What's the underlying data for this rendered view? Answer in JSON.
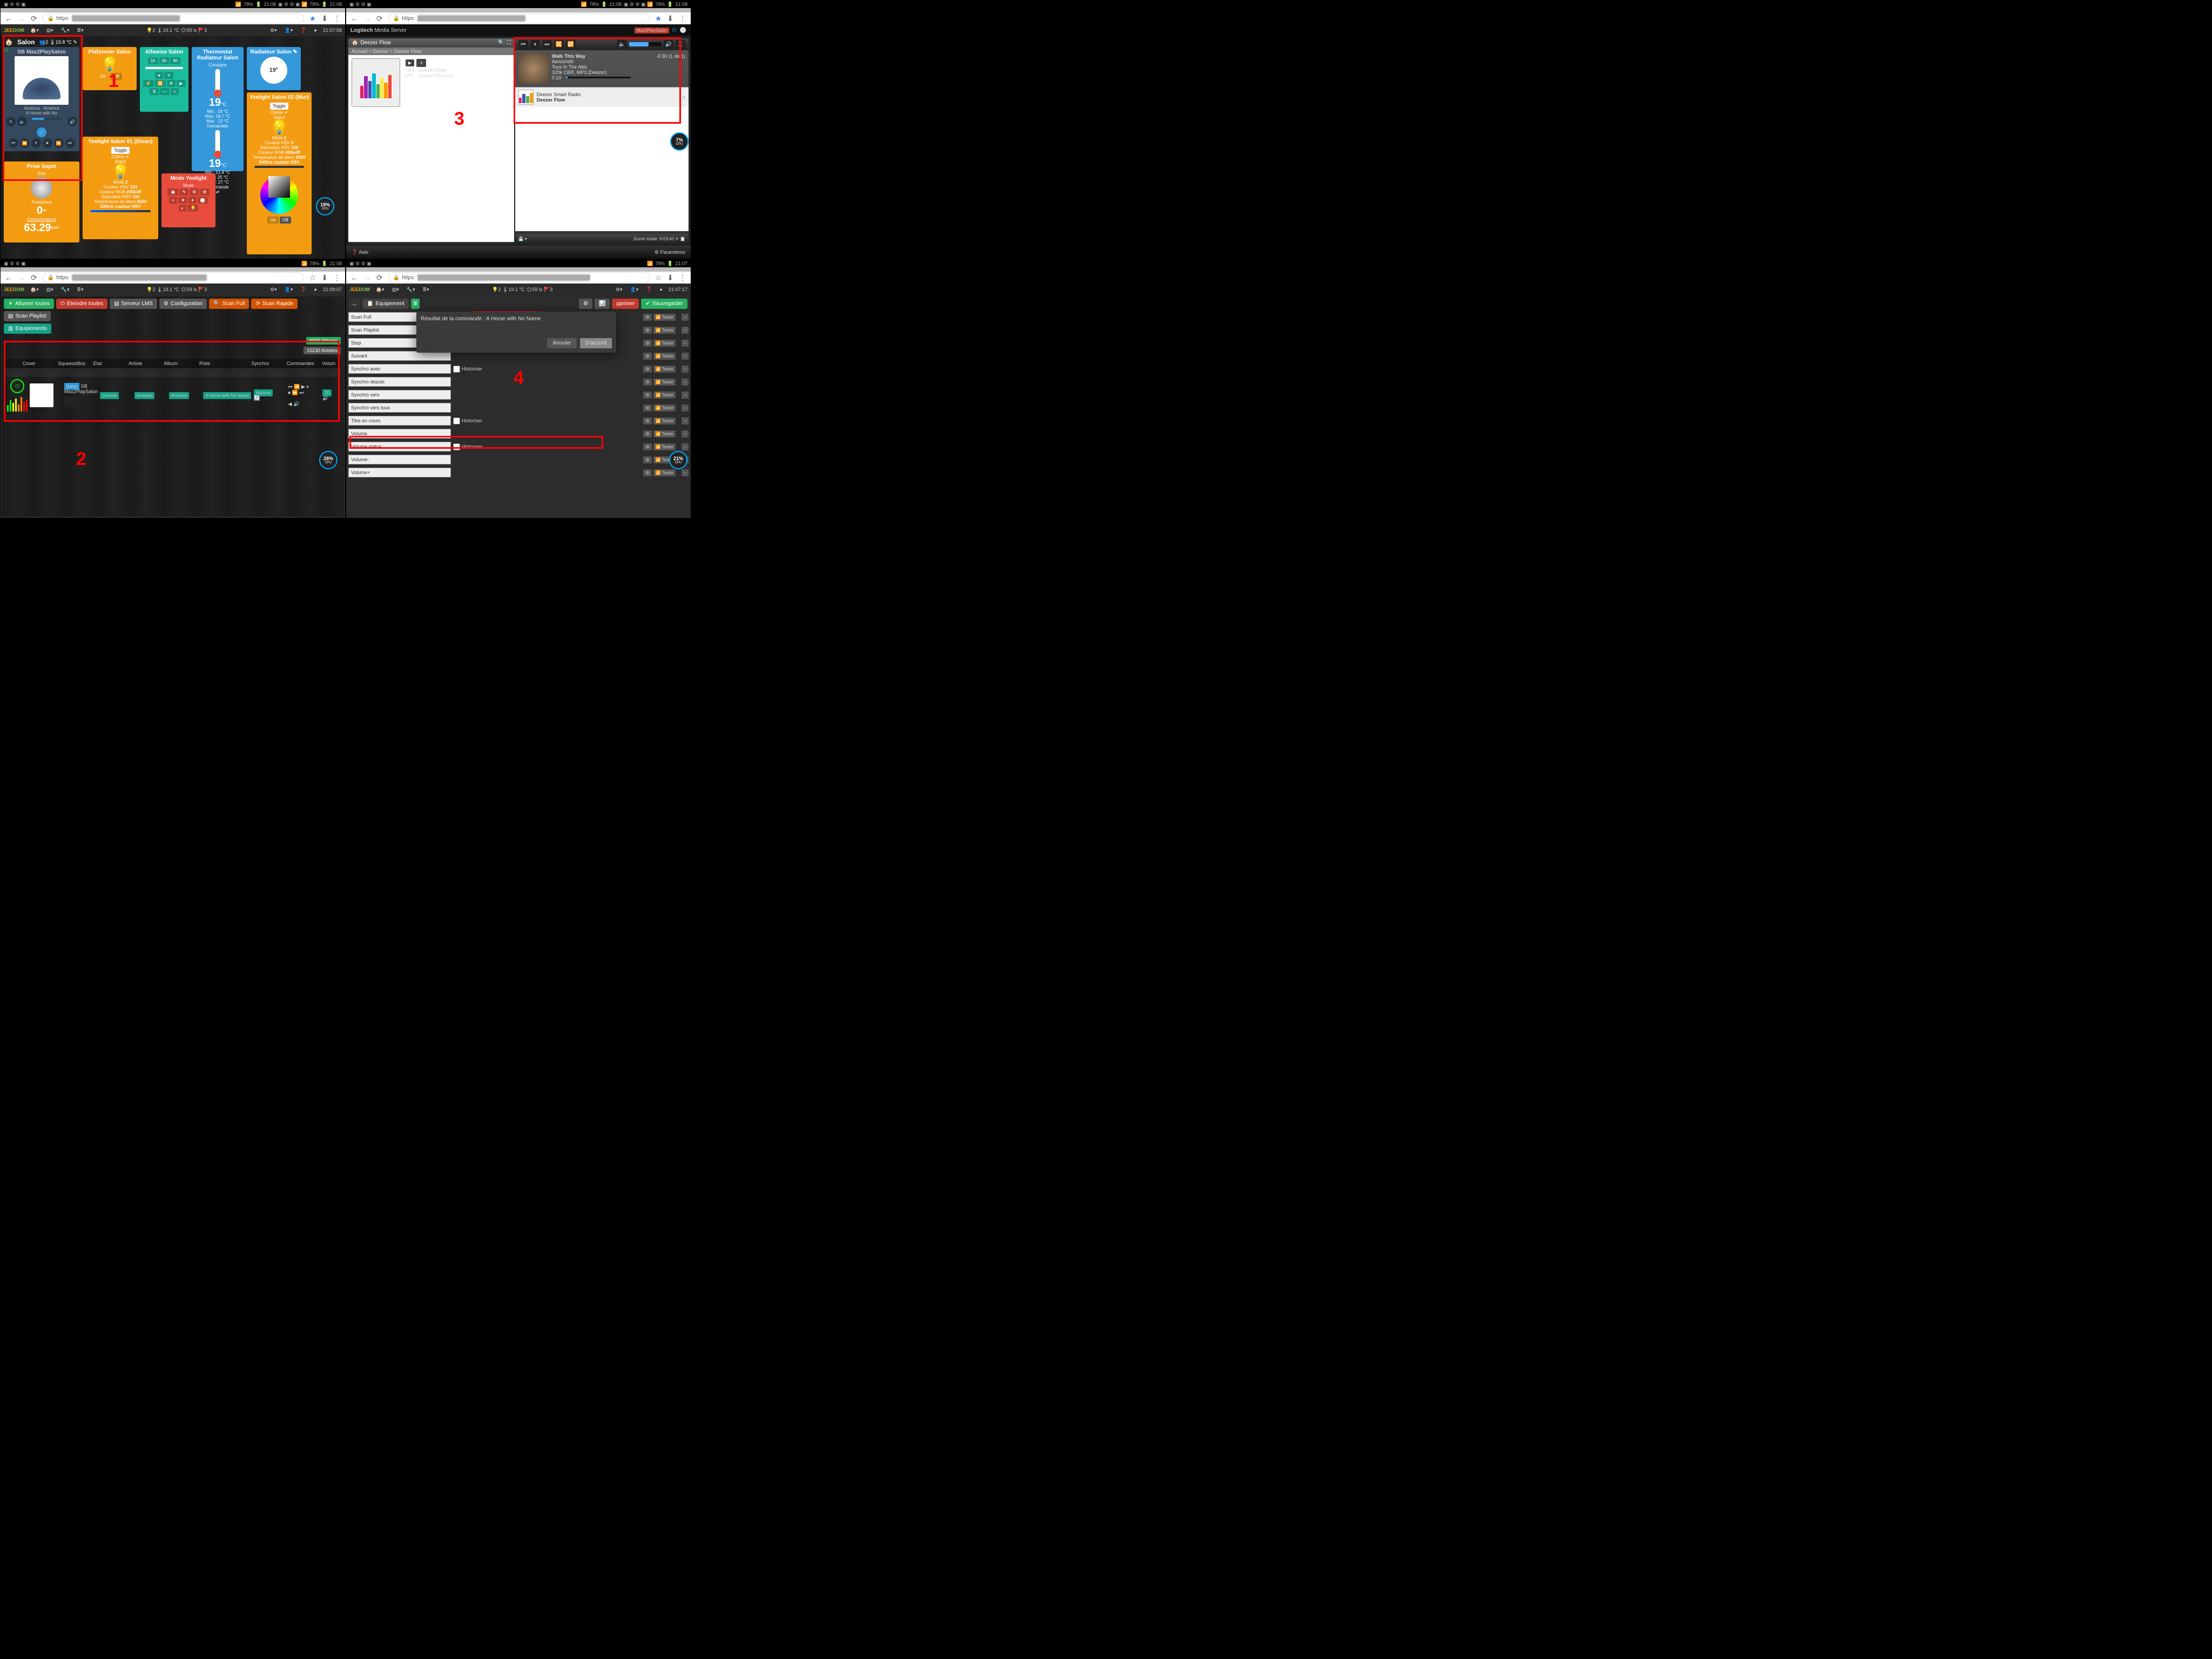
{
  "status": {
    "battery": "78%",
    "time": "21:08",
    "time4": "21:07"
  },
  "browser": {
    "prefix": "https:"
  },
  "jeedom": {
    "clock1": "21:07:58",
    "clock2": "21:08:07",
    "clock4": "21:07:17",
    "temp": "19.1 °C",
    "lux": "59 lx",
    "people": "2",
    "flags": "3"
  },
  "dash": {
    "room": "Salon",
    "in_temp": "19.8 °C",
    "cpu1": "19%",
    "cpu2": "28%",
    "cpu3": "7%",
    "cpu4": "21%"
  },
  "player": {
    "title": "SB Max2PlaySalon",
    "line1": "America - America",
    "line2": "A Horse with No"
  },
  "plaf": {
    "title": "Plafonnier Salon",
    "on": "On",
    "off": "Off"
  },
  "alf": {
    "title": "Alfawise Salon",
    "h1": "1h",
    "h3": "3h",
    "h6": "6h"
  },
  "therm": {
    "title": "Thermostat",
    "sub": "Radiateur Salon",
    "consigne": "Consigne",
    "v1": "19",
    "c": "°C",
    "demandee": "Demandée",
    "v2": "19",
    "min1": "Min :  18 °C",
    "moy1": "Moy:  18.7 °C",
    "max1": "Max :  22 °C",
    "min2": "Min :  21.4 °C",
    "moy2": "Moy:  25 °C",
    "max2": "Max :  27 °C",
    "cmd": "Commande"
  },
  "rad": {
    "title": "Radiateur Salon",
    "t": "19°"
  },
  "yee2": {
    "title": "Yeelight Salon 02 (Mur)",
    "online": "Online",
    "statut": "Statut",
    "mode": "Mode",
    "modev": "2",
    "chsv": "Couleur HSV",
    "chsvv": "0",
    "shsv": "Saturation HSV",
    "shsvv": "100",
    "crgb": "Couleur RGB",
    "crgbv": "#00b4ff",
    "tblanc": "Température de blanc",
    "tblancv": "6500",
    "def": "Définir couleur HSV"
  },
  "yee1": {
    "title": "Yeelight Salon 01 (Divan)",
    "toggle": "Toggle",
    "online": "Online",
    "statut": "Statut",
    "mode": "Mode",
    "modev": "2",
    "chsv": "Couleur HSV",
    "chsvv": "253",
    "crgb": "Couleur RGB",
    "crgbv": "#00b4ff",
    "shsv": "Saturation HSV",
    "shsvv": "100",
    "tblanc": "Température de blanc",
    "tblancv": "6500",
    "def": "Définir couleur HSV"
  },
  "modeY": {
    "title": "Mode Yeelight",
    "mode": "Mode"
  },
  "sapin": {
    "title": "Prise Sapin",
    "etat": "Etat",
    "puissance": "Puissance",
    "pv": "0",
    "pu": "W",
    "conso": "Consommation",
    "cv": "63.29",
    "cu": "kWh"
  },
  "lms": {
    "brand": "Logitech Media Server",
    "sel": "Max2PlaySalon",
    "flow": "Deezer Flow",
    "bc": "Accueil > Deezer > Deezer Flow",
    "titre": "Titre :",
    "titreV": "Deezer Flow",
    "url": "URL :",
    "urlV": "deezer://flow.dzr",
    "np_title": "Walk This Way",
    "np_artist": "Aerosmith",
    "np_album": "Toys In The Attic",
    "np_info": "320k CBR, MP3 (Deezer)",
    "np_elapsed": "0:10",
    "np_remain": "-3:30",
    "np_idx": "(1 de 1)",
    "pl1": "Deezer Smart Radio",
    "pl2": "Deezer Flow",
    "dur": "Durée totale: 0:03:40",
    "help": "Aide",
    "settings": "Paramètres"
  },
  "q2": {
    "btns": {
      "allumer": "Allumer toutes",
      "eteindre": "Eteindre toutes",
      "serveur": "Serveur LMS",
      "config": "Configuration",
      "scanfull": "Scan Full",
      "scanrapide": "Scan Rapide",
      "scanpl": "Scan Playlist",
      "equip": "Equipements"
    },
    "albums": "9092 Albums",
    "artistes": "15230 Artistes",
    "cols": {
      "cover": "Cover",
      "sb": "SqueezeBox",
      "etat": "Etat",
      "artiste": "Artiste",
      "album": "Album",
      "piste": "Piste",
      "synchro": "Synchro",
      "cmd": "Commandes",
      "vol": "Volum"
    },
    "row": {
      "sb_badge": "Salon",
      "sb": "SB Max2PlaySalon",
      "etat": "Lecture",
      "artiste": "America",
      "album": "America",
      "piste": "A Horse with No Name",
      "synchro": "Aucune",
      "vol": "20"
    }
  },
  "q4": {
    "btns": {
      "equip": "Equipement",
      "supp": "pprimer",
      "save": "Sauvegarder"
    },
    "modal": {
      "title": "Résultat de la commande : A Horse with No Name",
      "cancel": "Annuler",
      "ok": "D'accord"
    },
    "hist": "Historiser",
    "tester": "Tester",
    "cmds": [
      "Scan Full",
      "Scan Playlist",
      "Stop",
      "Suivant",
      "Synchro avec",
      "Synchro depuis",
      "Synchro vers",
      "Synchro vers tous",
      "Titre en cours",
      "Volume",
      "Volume status",
      "Volume-",
      "Volume+"
    ]
  },
  "lbl": {
    "on": "On",
    "off": "Off",
    "toggle": "Toggle",
    "cpu": "CPU"
  }
}
